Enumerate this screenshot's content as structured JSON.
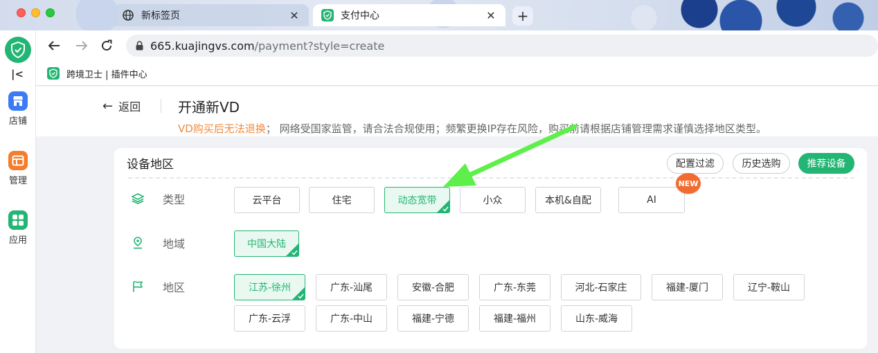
{
  "browser": {
    "tabs": [
      {
        "title": "新标签页",
        "icon": "globe-icon",
        "active": false
      },
      {
        "title": "支付中心",
        "icon": "shield-icon",
        "active": true
      }
    ],
    "close_glyph": "✕",
    "new_tab_glyph": "+",
    "url_host": "665.kuajingvs.com",
    "url_path": "/payment?style=create",
    "bookmark": "跨境卫士 | 插件中心"
  },
  "sidebar": {
    "collapse_glyph": "|<",
    "items": [
      {
        "label": "店铺",
        "icon": "store-icon",
        "color": "#3b7cf5"
      },
      {
        "label": "管理",
        "icon": "manage-icon",
        "color": "#f57c2b"
      },
      {
        "label": "应用",
        "icon": "apps-icon",
        "color": "#22b573"
      }
    ]
  },
  "header": {
    "back_label": "返回",
    "back_arrow": "←",
    "title": "开通新VD",
    "warning_emphasis": "VD购买后无法退换",
    "warning_rest": "； 网络受国家监管，请合法合规使用；频繁更换IP存在风险，购买前请根据店铺管理需求谨慎选择地区类型。"
  },
  "card": {
    "title": "设备地区",
    "filter_button": "配置过滤",
    "history_button": "历史选购",
    "recommend_button": "推荐设备",
    "new_badge": "NEW",
    "rows": {
      "type_label": "类型",
      "domain_label": "地域",
      "region_label": "地区"
    },
    "types": [
      "云平台",
      "住宅",
      "动态宽带",
      "小众",
      "本机&自配",
      "AI"
    ],
    "selected_type": "动态宽带",
    "domains": [
      "中国大陆"
    ],
    "regions": [
      "江苏-徐州",
      "广东-汕尾",
      "安徽-合肥",
      "广东-东莞",
      "河北-石家庄",
      "福建-厦门",
      "辽宁-鞍山",
      "广东-云浮",
      "广东-中山",
      "福建-宁德",
      "福建-福州",
      "山东-威海"
    ],
    "selected_region": "江苏-徐州"
  },
  "colors": {
    "accent": "#22b573",
    "warning": "#f08a3c",
    "badge": "#f26b2f",
    "annotation_arrow": "#5ef04a"
  }
}
